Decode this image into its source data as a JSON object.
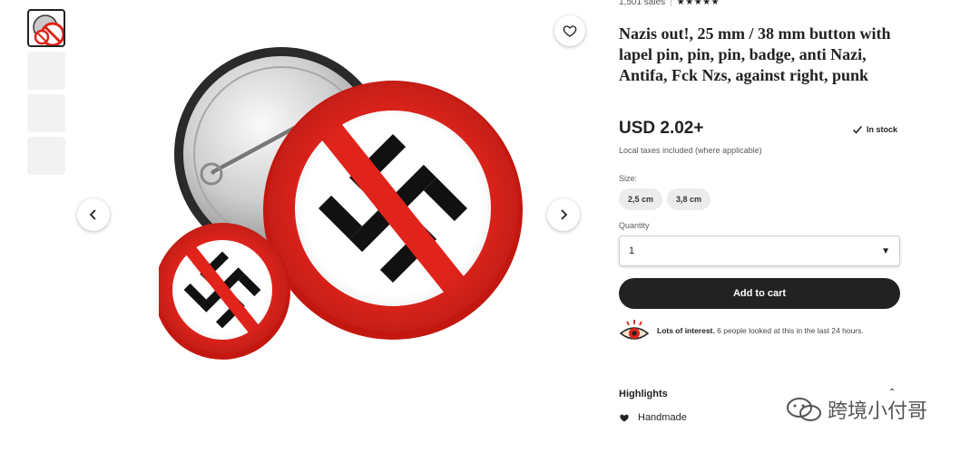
{
  "header": {
    "sales_count": "1,501 sales",
    "stars": "★★★★★"
  },
  "product": {
    "title": "Nazis out!, 25 mm / 38 mm button with lapel pin, pin, pin, badge, anti Nazi, Antifa, Fck Nzs, against right, punk",
    "price": "USD 2.02+",
    "stock": "In stock",
    "taxes_note": "Local taxes included (where applicable)"
  },
  "size": {
    "label": "Size:",
    "options": [
      "2,5 cm",
      "3,8 cm"
    ]
  },
  "quantity": {
    "label": "Quantity",
    "value": "1"
  },
  "cart": {
    "button_label": "Add to cart"
  },
  "interest": {
    "bold": "Lots of interest.",
    "text": " 6 people looked at this in the last 24 hours."
  },
  "highlights": {
    "title": "Highlights",
    "items": [
      "Handmade"
    ]
  },
  "watermark": {
    "text": "跨境小付哥"
  },
  "icons": {
    "favorite": "heart-icon",
    "prev": "chevron-left-icon",
    "next": "chevron-right-icon",
    "stock": "check-icon",
    "dropdown": "caret-down-icon",
    "interest": "eye-icon",
    "handmade": "hand-heart-icon",
    "collapse": "chevron-up-icon"
  },
  "colors": {
    "button_red": "#e0231b",
    "primary_dark": "#222222"
  }
}
